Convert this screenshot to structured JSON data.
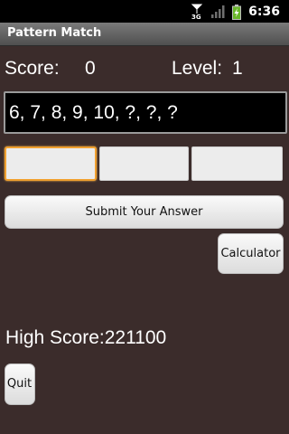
{
  "status_bar": {
    "network": "3G",
    "time": "6:36"
  },
  "app": {
    "title": "Pattern Match"
  },
  "score": {
    "label": "Score:",
    "value": "0"
  },
  "level": {
    "label": "Level:",
    "value": "1"
  },
  "sequence": "6, 7, 8, 9, 10, ?, ?, ?",
  "answers": [
    "",
    "",
    ""
  ],
  "buttons": {
    "submit": "Submit Your Answer",
    "calculator": "Calculator",
    "quit": "Quit"
  },
  "high_score": "High Score:221100",
  "colors": {
    "background": "#3b2c2b",
    "focus_border": "#f0a030"
  }
}
